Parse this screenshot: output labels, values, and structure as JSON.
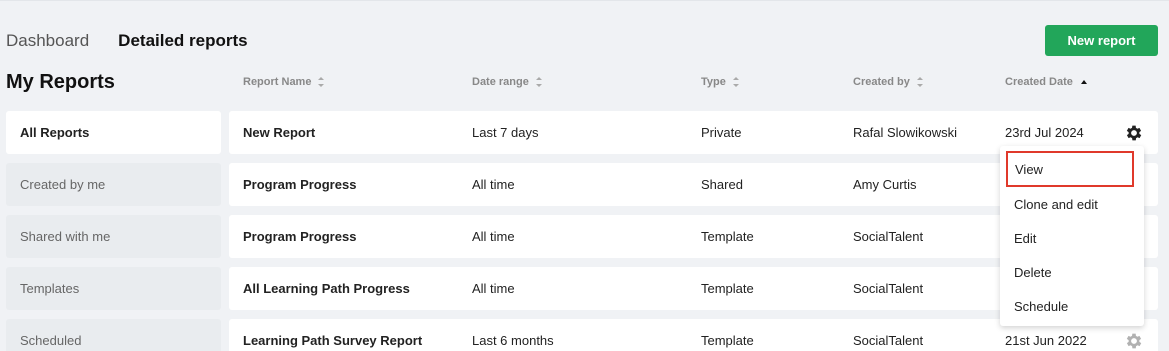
{
  "tabs": {
    "dashboard": "Dashboard",
    "detailed": "Detailed reports"
  },
  "toolbar": {
    "new_report_label": "New report"
  },
  "page_title": "My Reports",
  "columns": {
    "name": "Report Name",
    "range": "Date range",
    "type": "Type",
    "by": "Created by",
    "date": "Created Date"
  },
  "sidebar": {
    "items": [
      {
        "label": "All Reports",
        "active": true
      },
      {
        "label": "Created by me"
      },
      {
        "label": "Shared with me"
      },
      {
        "label": "Templates"
      },
      {
        "label": "Scheduled"
      }
    ]
  },
  "rows": [
    {
      "name": "New Report",
      "range": "Last 7 days",
      "type": "Private",
      "by": "Rafal Slowikowski",
      "date": "23rd Jul 2024"
    },
    {
      "name": "Program Progress",
      "range": "All time",
      "type": "Shared",
      "by": "Amy Curtis",
      "date": ""
    },
    {
      "name": "Program Progress",
      "range": "All time",
      "type": "Template",
      "by": "SocialTalent",
      "date": ""
    },
    {
      "name": "All Learning Path Progress",
      "range": "All time",
      "type": "Template",
      "by": "SocialTalent",
      "date": ""
    },
    {
      "name": "Learning Path Survey Report",
      "range": "Last 6 months",
      "type": "Template",
      "by": "SocialTalent",
      "date": "21st Jun 2022"
    }
  ],
  "menu": {
    "items": [
      "View",
      "Clone and edit",
      "Edit",
      "Delete",
      "Schedule"
    ]
  },
  "colors": {
    "primary_button": "#22a65a",
    "highlight_border": "#e0392b"
  }
}
